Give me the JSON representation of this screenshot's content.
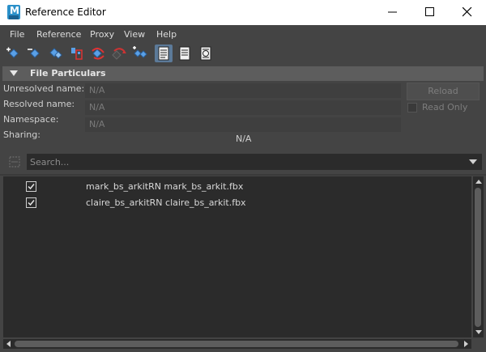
{
  "window": {
    "title": "Reference Editor",
    "app_icon": "maya-icon",
    "app_icon_letter": "M"
  },
  "menu": [
    "File",
    "Reference",
    "Proxy",
    "View",
    "Help"
  ],
  "toolbar": {
    "icons": [
      "create-reference-icon",
      "remove-reference-icon",
      "reload-reference-icon",
      "import-objects-icon",
      "unload-reference-icon",
      "duplicate-reference-icon",
      "replace-reference-icon",
      "list-view-icon",
      "attributes-view-icon",
      "namespace-view-icon"
    ],
    "active": "list-view-icon"
  },
  "file_particulars": {
    "header": "File Particulars",
    "unresolved_label": "Unresolved name:",
    "unresolved_value": "N/A",
    "resolved_label": "Resolved name:",
    "resolved_value": "N/A",
    "namespace_label": "Namespace:",
    "namespace_value": "N/A",
    "sharing_label": "Sharing:",
    "sharing_value": "N/A",
    "reload_label": "Reload",
    "read_only_label": "Read Only"
  },
  "search": {
    "placeholder": "Search..."
  },
  "references": [
    {
      "label": "mark_bs_arkitRN mark_bs_arkit.fbx",
      "checked": true
    },
    {
      "label": "claire_bs_arkitRN claire_bs_arkit.fbx",
      "checked": true
    }
  ],
  "colors": {
    "background": "#444444",
    "list_background": "#2b2b2b",
    "header_background": "#5d5d5d",
    "active_tool": "#5c7a99",
    "app_icon": "#2b90c9"
  }
}
